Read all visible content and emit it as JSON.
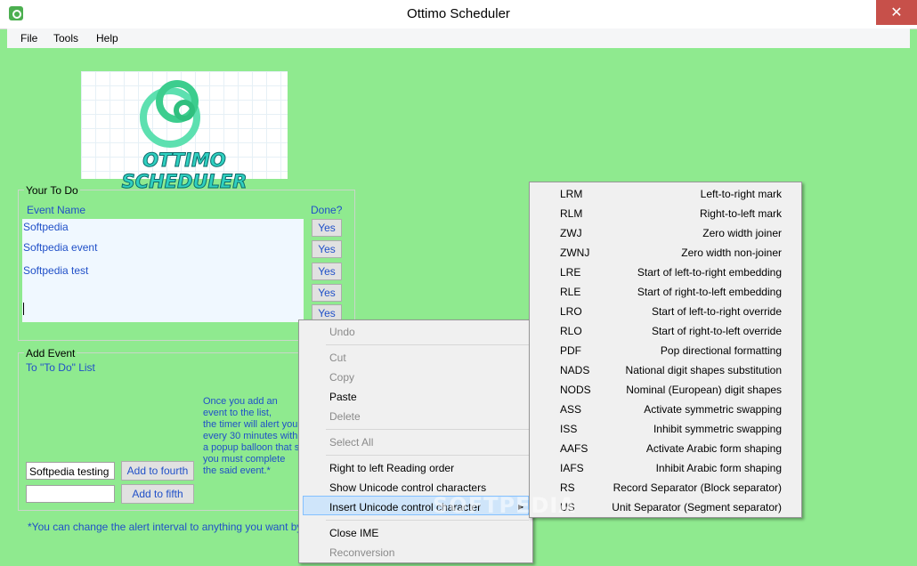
{
  "window": {
    "title": "Ottimo Scheduler",
    "close": "✕"
  },
  "menubar": {
    "file": "File",
    "tools": "Tools",
    "help": "Help"
  },
  "logo": {
    "text": "OTTIMO SCHEDULER"
  },
  "todo": {
    "group_title": "Your To Do",
    "col_event": "Event Name",
    "col_done": "Done?",
    "items": [
      "Softpedia",
      "Softpedia event",
      "Softpedia test"
    ],
    "yes_label": "Yes"
  },
  "add_event": {
    "group_title": "Add Event",
    "subtitle": "To \"To Do\" List",
    "info_lines": [
      "Once you add an",
      "event to the list,",
      "the timer will alert you",
      "every 30 minutes with",
      "a popup balloon that s",
      "you must complete",
      "the said event.*"
    ],
    "input1_value": "Softpedia testing",
    "input2_value": "",
    "btn_fourth": "Add to fourth",
    "btn_fifth": "Add to fifth",
    "footnote": "*You can change the alert interval to anything you want by clickin"
  },
  "context_menu": {
    "undo": "Undo",
    "cut": "Cut",
    "copy": "Copy",
    "paste": "Paste",
    "delete": "Delete",
    "select_all": "Select All",
    "rtl": "Right to left Reading order",
    "show_unicode": "Show Unicode control characters",
    "insert_unicode": "Insert Unicode control character",
    "close_ime": "Close IME",
    "reconversion": "Reconversion",
    "arrow": "▶"
  },
  "submenu": [
    {
      "code": "LRM",
      "desc": "Left-to-right mark"
    },
    {
      "code": "RLM",
      "desc": "Right-to-left mark"
    },
    {
      "code": "ZWJ",
      "desc": "Zero width joiner"
    },
    {
      "code": "ZWNJ",
      "desc": "Zero width non-joiner"
    },
    {
      "code": "LRE",
      "desc": "Start of left-to-right embedding"
    },
    {
      "code": "RLE",
      "desc": "Start of right-to-left embedding"
    },
    {
      "code": "LRO",
      "desc": "Start of left-to-right override"
    },
    {
      "code": "RLO",
      "desc": "Start of right-to-left override"
    },
    {
      "code": "PDF",
      "desc": "Pop directional formatting"
    },
    {
      "code": "NADS",
      "desc": "National digit shapes substitution"
    },
    {
      "code": "NODS",
      "desc": "Nominal (European) digit shapes"
    },
    {
      "code": "ASS",
      "desc": "Activate symmetric swapping"
    },
    {
      "code": "ISS",
      "desc": "Inhibit symmetric swapping"
    },
    {
      "code": "AAFS",
      "desc": "Activate Arabic form shaping"
    },
    {
      "code": "IAFS",
      "desc": "Inhibit Arabic form shaping"
    },
    {
      "code": "RS",
      "desc": "Record Separator (Block separator)"
    },
    {
      "code": "US",
      "desc": "Unit Separator (Segment separator)"
    }
  ],
  "watermark": "SOFTPEDIA"
}
